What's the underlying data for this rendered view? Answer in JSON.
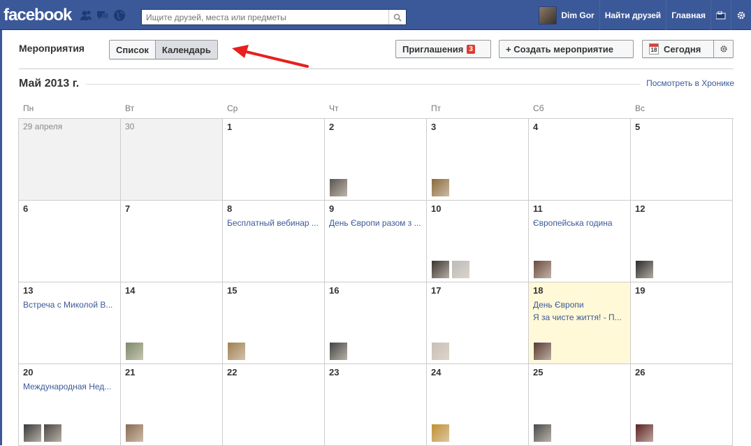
{
  "topbar": {
    "logo": "facebook",
    "search_placeholder": "Ищите друзей, места или предметы",
    "user_name": "Dim Gor",
    "find_friends": "Найти друзей",
    "home": "Главная"
  },
  "header": {
    "title": "Мероприятия",
    "tab_list": "Список",
    "tab_calendar": "Календарь",
    "invitations_label": "Приглашения",
    "invitations_count": "3",
    "create_label": "+ Создать мероприятие",
    "today_label": "Сегодня",
    "today_icon_day": "18"
  },
  "calendar": {
    "month": "Май 2013 г.",
    "timeline_link": "Посмотреть в Хронике",
    "days_of_week": [
      "Пн",
      "Вт",
      "Ср",
      "Чт",
      "Пт",
      "Сб",
      "Вс"
    ],
    "weeks": [
      [
        {
          "date": "29 апреля",
          "past": true,
          "events": [],
          "thumbs": []
        },
        {
          "date": "30",
          "past": true,
          "events": [],
          "thumbs": []
        },
        {
          "date": "1",
          "events": [],
          "thumbs": []
        },
        {
          "date": "2",
          "events": [],
          "thumbs": [
            "#5a5550"
          ]
        },
        {
          "date": "3",
          "events": [],
          "thumbs": [
            "#8a6a3a"
          ]
        },
        {
          "date": "4",
          "events": [],
          "thumbs": []
        },
        {
          "date": "5",
          "events": [],
          "thumbs": []
        }
      ],
      [
        {
          "date": "6",
          "events": [],
          "thumbs": []
        },
        {
          "date": "7",
          "events": [],
          "thumbs": []
        },
        {
          "date": "8",
          "events": [
            "Бесплатный вебинар ..."
          ],
          "thumbs": []
        },
        {
          "date": "9",
          "events": [
            "День Європи разом з ..."
          ],
          "thumbs": []
        },
        {
          "date": "10",
          "events": [],
          "thumbs": [
            "#3a3430",
            "#bbbbbb"
          ]
        },
        {
          "date": "11",
          "events": [
            "Європейська година"
          ],
          "thumbs": [
            "#6a4a40"
          ]
        },
        {
          "date": "12",
          "events": [],
          "thumbs": [
            "#2a2a2a"
          ]
        }
      ],
      [
        {
          "date": "13",
          "events": [
            "Встреча с Миколой В..."
          ],
          "thumbs": []
        },
        {
          "date": "14",
          "events": [],
          "thumbs": [
            "#7a8a6a"
          ]
        },
        {
          "date": "15",
          "events": [],
          "thumbs": [
            "#a08050"
          ]
        },
        {
          "date": "16",
          "events": [],
          "thumbs": [
            "#444444"
          ]
        },
        {
          "date": "17",
          "events": [],
          "thumbs": [
            "#c8c0b8"
          ]
        },
        {
          "date": "18",
          "today": true,
          "events": [
            "День Європи",
            "Я за чисте життя! - П..."
          ],
          "thumbs": [
            "#5a3a30"
          ]
        },
        {
          "date": "19",
          "events": [],
          "thumbs": []
        }
      ],
      [
        {
          "date": "20",
          "events": [
            "Международная Нед..."
          ],
          "thumbs": [
            "#3a3a3a",
            "#4a4540"
          ]
        },
        {
          "date": "21",
          "events": [],
          "thumbs": [
            "#8a6a50"
          ]
        },
        {
          "date": "22",
          "events": [],
          "thumbs": []
        },
        {
          "date": "23",
          "events": [],
          "thumbs": []
        },
        {
          "date": "24",
          "events": [],
          "thumbs": [
            "#c09030"
          ]
        },
        {
          "date": "25",
          "events": [],
          "thumbs": [
            "#4a4a4a"
          ]
        },
        {
          "date": "26",
          "events": [],
          "thumbs": [
            "#5a2020"
          ]
        }
      ]
    ]
  }
}
